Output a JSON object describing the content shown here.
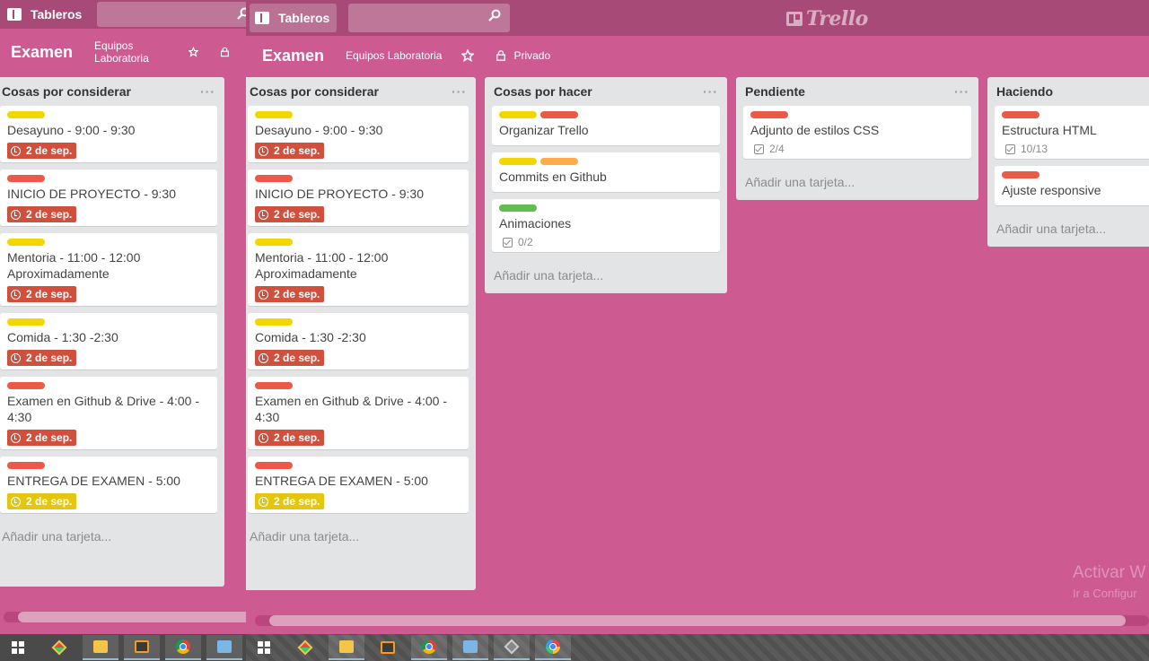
{
  "header": {
    "boards_label": "Tableros",
    "logo_text": "Trello"
  },
  "board": {
    "title": "Examen",
    "team": "Equipos Laboratoria",
    "visibility": "Privado"
  },
  "colors": {
    "background": "#cd5a91",
    "header": "#a84a77",
    "label_yellow": "#f2d600",
    "label_red": "#eb5a46",
    "label_orange": "#ffab4a",
    "label_green": "#61bd4f",
    "due_red": "#cf513d",
    "due_yellow": "#e6c60d"
  },
  "lists": [
    {
      "title": "Cosas por considerar",
      "menu": "···",
      "add_card": "Añadir una tarjeta...",
      "cards": [
        {
          "title": "Desayuno - 9:00 - 9:30",
          "labels": [
            "yellow"
          ],
          "due": "2 de sep.",
          "due_color": "red"
        },
        {
          "title": "INICIO DE PROYECTO - 9:30",
          "labels": [
            "red"
          ],
          "due": "2 de sep.",
          "due_color": "red"
        },
        {
          "title": "Mentoria - 11:00 - 12:00 Aproximadamente",
          "labels": [
            "yellow"
          ],
          "due": "2 de sep.",
          "due_color": "red"
        },
        {
          "title": "Comida - 1:30 -2:30",
          "labels": [
            "yellow"
          ],
          "due": "2 de sep.",
          "due_color": "red"
        },
        {
          "title": "Examen en Github & Drive - 4:00 - 4:30",
          "labels": [
            "red"
          ],
          "due": "2 de sep.",
          "due_color": "red"
        },
        {
          "title": "ENTREGA DE EXAMEN - 5:00",
          "labels": [
            "red"
          ],
          "due": "2 de sep.",
          "due_color": "yellow"
        }
      ]
    },
    {
      "title": "Cosas por hacer",
      "menu": "···",
      "add_card": "Añadir una tarjeta...",
      "cards": [
        {
          "title": "Organizar Trello",
          "labels": [
            "yellow",
            "red"
          ]
        },
        {
          "title": "Commits en Github",
          "labels": [
            "yellow",
            "orange"
          ]
        },
        {
          "title": "Animaciones",
          "labels": [
            "green"
          ],
          "checklist": "0/2"
        }
      ]
    },
    {
      "title": "Pendiente",
      "menu": "···",
      "add_card": "Añadir una tarjeta...",
      "cards": [
        {
          "title": "Adjunto de estilos CSS",
          "labels": [
            "red"
          ],
          "checklist": "2/4"
        }
      ]
    },
    {
      "title": "Haciendo",
      "menu": "···",
      "add_card": "Añadir una tarjeta...",
      "cards": [
        {
          "title": "Estructura HTML",
          "labels": [
            "red"
          ],
          "checklist": "10/13"
        },
        {
          "title": "Ajuste responsive",
          "labels": [
            "red"
          ]
        }
      ]
    }
  ],
  "watermark": {
    "line1": "Activar W",
    "line2": "Ir a Configur"
  },
  "taskbar": {
    "icons": [
      "start-icon",
      "git-kraken-icon",
      "file-explorer-icon",
      "sublime-icon",
      "chrome-icon",
      "photos-icon",
      "git-icon",
      "paint-icon"
    ]
  }
}
